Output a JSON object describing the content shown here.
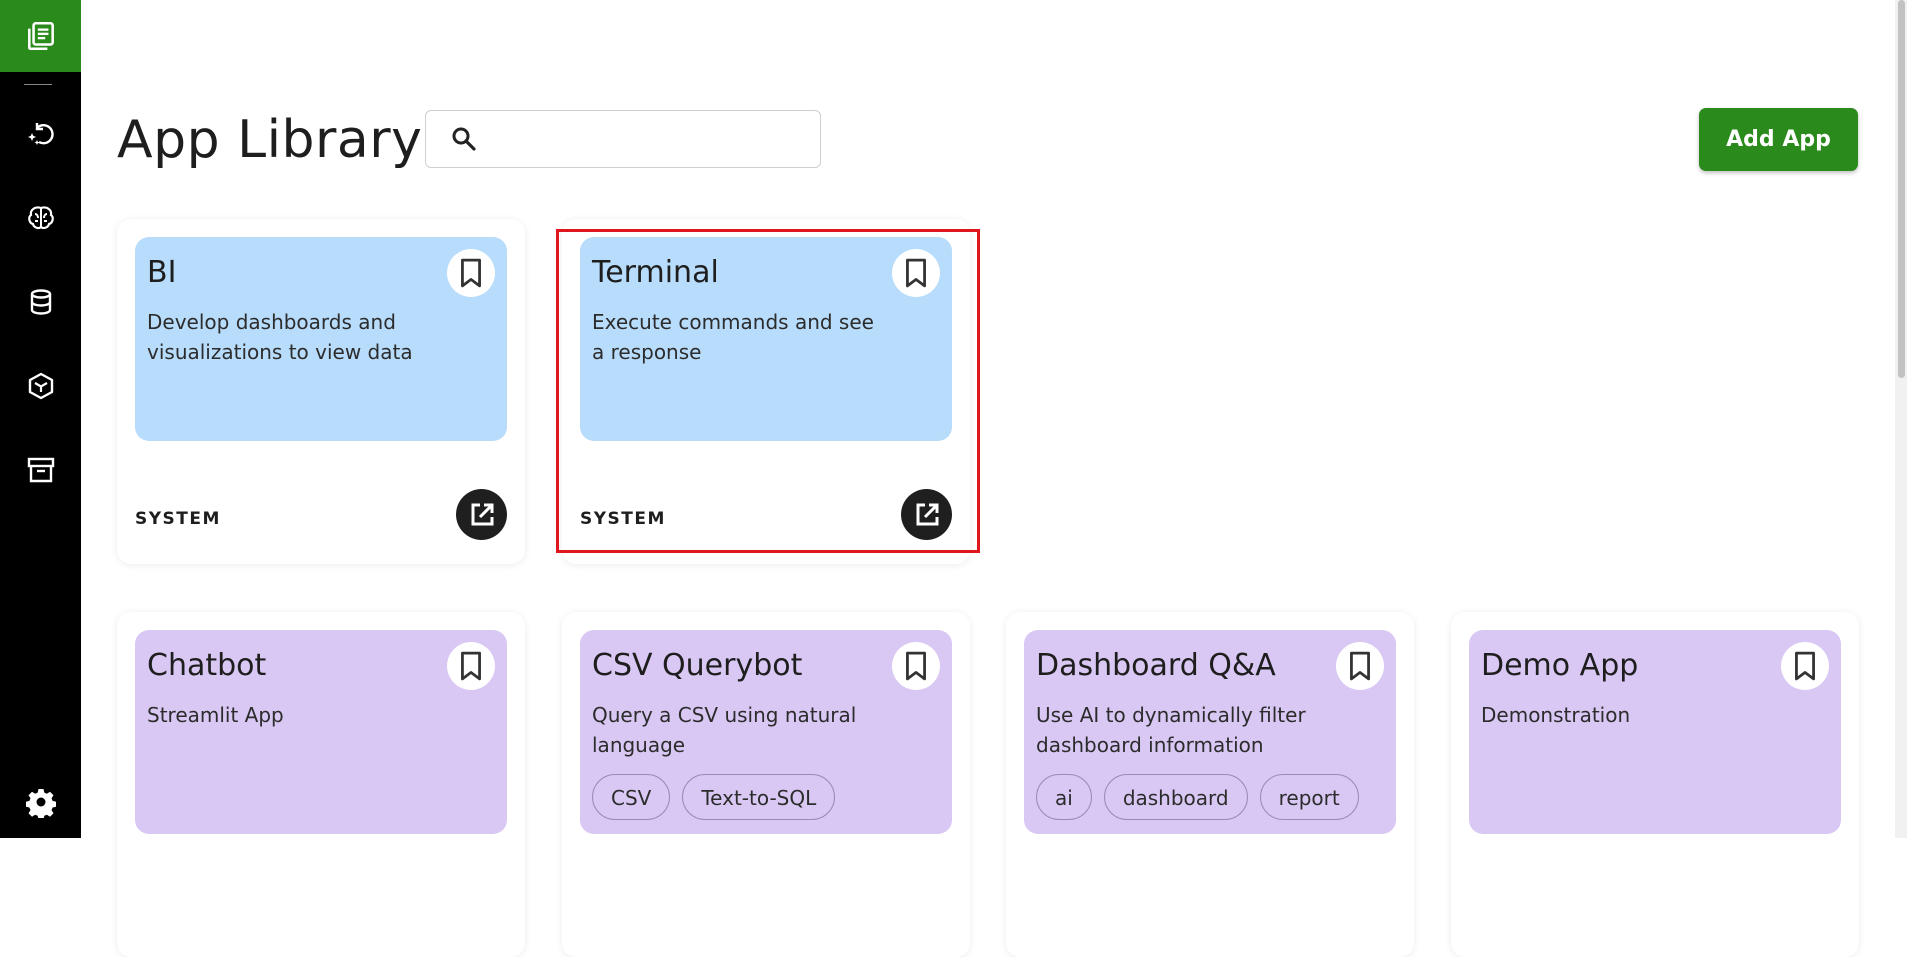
{
  "header": {
    "title": "App Library",
    "add_button": "Add App",
    "search_placeholder": ""
  },
  "sidebar": {
    "items": [
      {
        "icon": "library-icon"
      },
      {
        "icon": "sparkle-refresh-icon"
      },
      {
        "icon": "brain-icon"
      },
      {
        "icon": "database-icon"
      },
      {
        "icon": "cube-icon"
      },
      {
        "icon": "archive-icon"
      },
      {
        "icon": "settings-gear-icon"
      }
    ]
  },
  "cards_row1": [
    {
      "name": "BI",
      "description": "Develop dashboards and visualizations to view data",
      "source": "SYSTEM",
      "color": "#b8dcfb"
    },
    {
      "name": "Terminal",
      "description": "Execute commands and see a response",
      "source": "SYSTEM",
      "color": "#b8dcfb"
    }
  ],
  "cards_row2": [
    {
      "name": "Chatbot",
      "description": "Streamlit App",
      "tags": [],
      "color": "#d9c8f4"
    },
    {
      "name": "CSV Querybot",
      "description": "Query a CSV using natural language",
      "tags": [
        "CSV",
        "Text-to-SQL"
      ],
      "color": "#d9c8f4"
    },
    {
      "name": "Dashboard Q&A",
      "description": "Use AI to dynamically filter dashboard information",
      "tags": [
        "ai",
        "dashboard",
        "report"
      ],
      "color": "#d9c8f4"
    },
    {
      "name": "Demo App",
      "description": "Demonstration",
      "tags": [],
      "color": "#d9c8f4"
    }
  ],
  "colors": {
    "accent": "#2b8a1c",
    "sidebar": "#000000",
    "highlight": "#e0161f"
  }
}
